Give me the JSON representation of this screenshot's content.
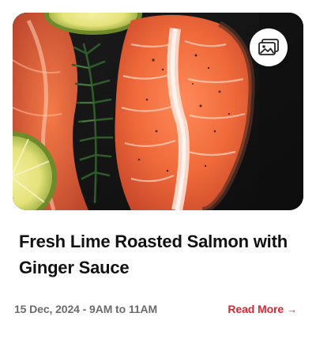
{
  "card": {
    "title": "Fresh Lime Roasted Salmon with Ginger Sauce",
    "date_time": "15 Dec, 2024 - 9AM to 11AM",
    "read_more_label": "Read More",
    "read_more_arrow": "→",
    "gallery_icon": "gallery-icon",
    "image_subject": "salmon-steaks-with-lime-and-rosemary"
  },
  "colors": {
    "accent": "#e0242f",
    "title": "#111111",
    "meta": "#6b6b6b",
    "background": "#ffffff"
  }
}
